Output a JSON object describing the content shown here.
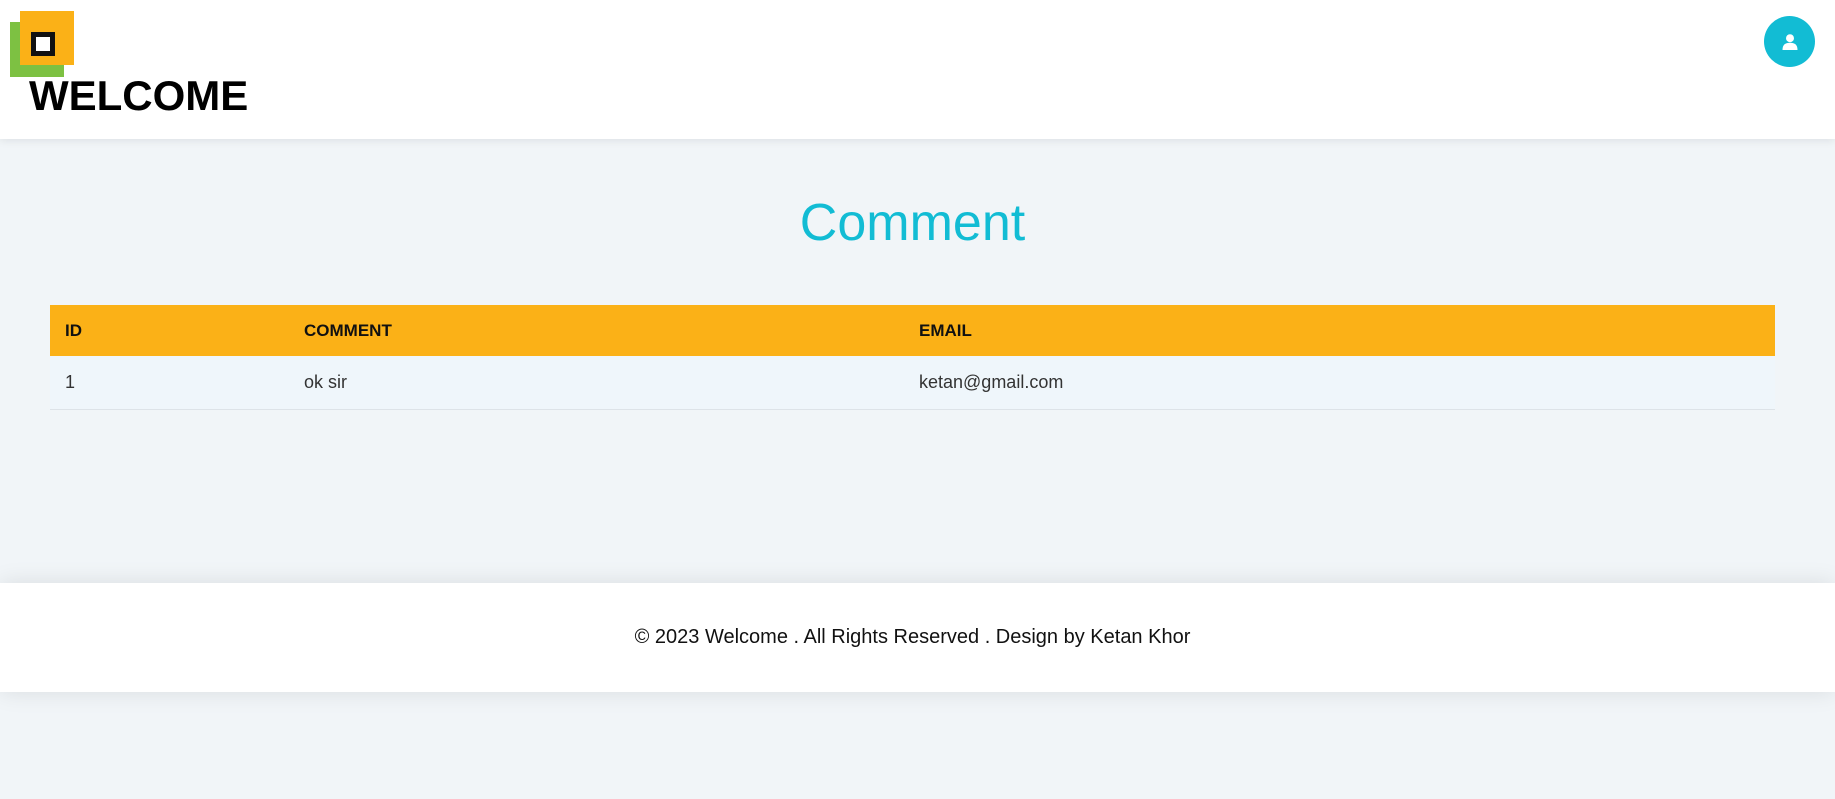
{
  "header": {
    "brand_title": "WELCOME",
    "logo_icon": "logo-squares-icon",
    "user_icon": "user-icon",
    "colors": {
      "logo_green": "#7dc142",
      "logo_orange": "#fbb117",
      "user_button_bg": "#12bcd4"
    }
  },
  "main": {
    "title": "Comment",
    "table": {
      "columns": [
        "ID",
        "COMMENT",
        "EMAIL"
      ],
      "rows": [
        [
          "1",
          "ok sir",
          "ketan@gmail.com"
        ]
      ]
    },
    "colors": {
      "title": "#12bcd4",
      "table_header_bg": "#fbb117",
      "page_bg": "#f1f5f8"
    }
  },
  "footer": {
    "text": "© 2023 Welcome . All Rights Reserved . Design by Ketan Khor"
  }
}
